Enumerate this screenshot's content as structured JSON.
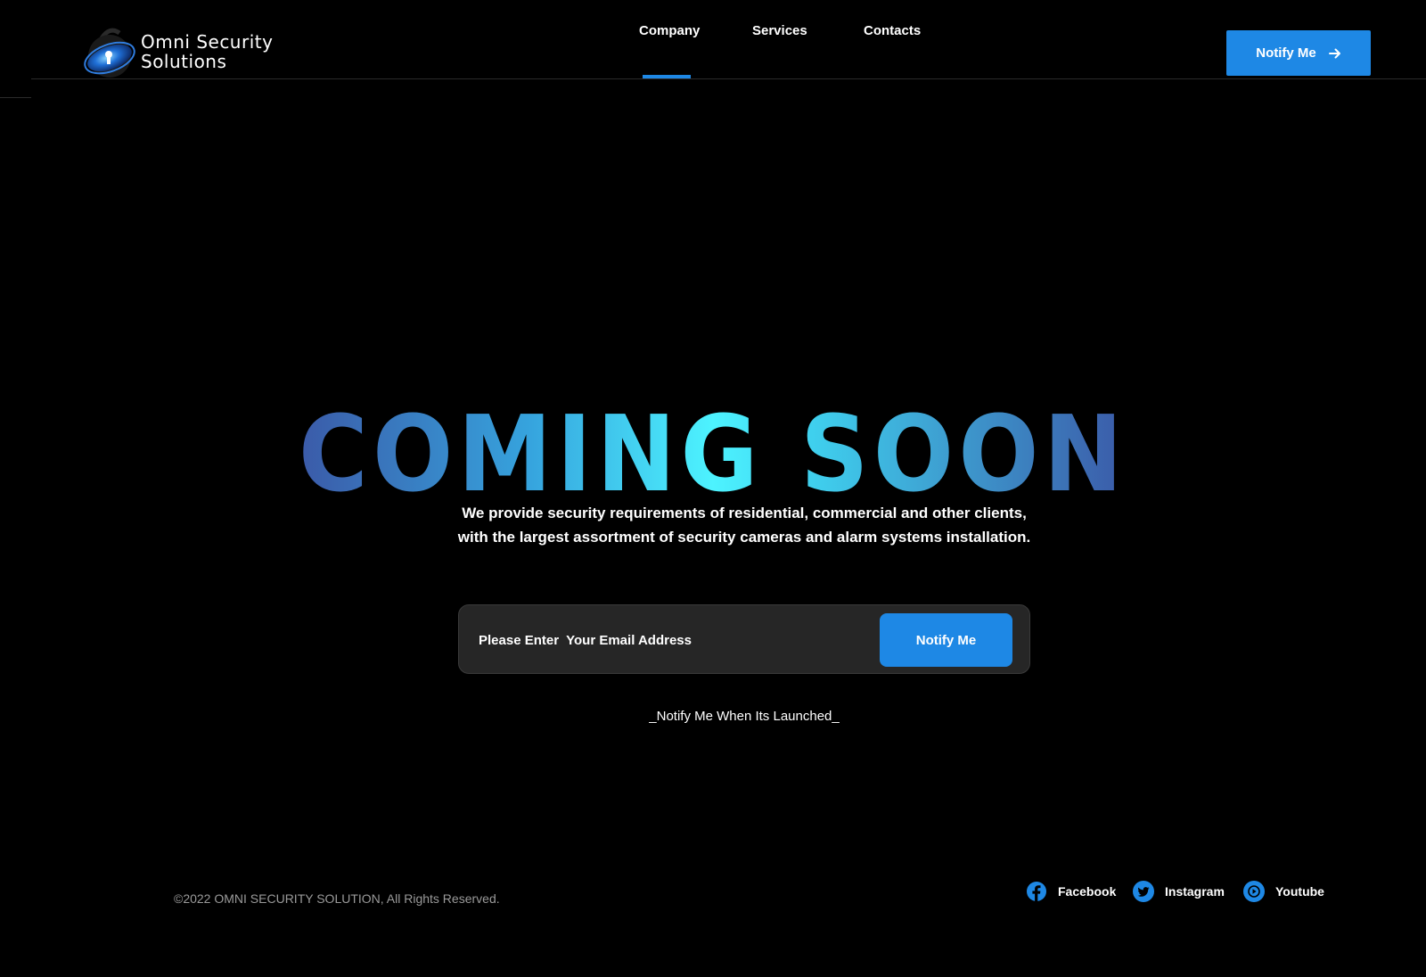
{
  "brand": {
    "name_line1": "Omni Security",
    "name_line2": "Solutions",
    "logo_icon": "keyhole-globe-icon"
  },
  "nav": {
    "items": [
      {
        "label": "Company",
        "active": true
      },
      {
        "label": "Services",
        "active": false
      },
      {
        "label": "Contacts",
        "active": false
      }
    ]
  },
  "header": {
    "notify_label": "Notify Me",
    "notify_icon": "arrow-right-icon"
  },
  "hero": {
    "title": "COMING SOON",
    "description_line1": "We provide security requirements of residential, commercial and other clients,",
    "description_line2": "with the largest assortment of security cameras and alarm systems installation."
  },
  "subscribe": {
    "placeholder": "Please Enter  Your Email Address",
    "button_label": "Notify Me",
    "note": "_Notify Me When Its Launched_"
  },
  "footer": {
    "copyright": "©2022 OMNI SECURITY SOLUTION, All Rights Reserved.",
    "social": [
      {
        "label": "Facebook",
        "icon": "facebook-icon"
      },
      {
        "label": "Instagram",
        "icon": "twitter-icon"
      },
      {
        "label": "Youtube",
        "icon": "youtube-icon"
      }
    ]
  },
  "colors": {
    "background": "#000000",
    "accent": "#1e88e5",
    "gradient_edge": "#3b5aa8",
    "gradient_center": "#4df3ff",
    "input_bg": "#262626",
    "muted_text": "#9a9a9a"
  }
}
